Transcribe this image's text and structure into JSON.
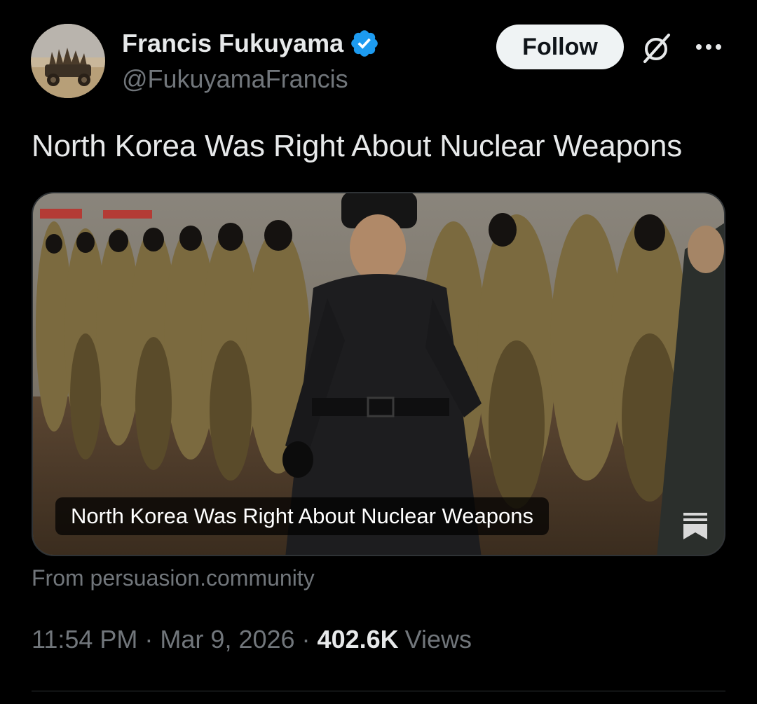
{
  "author": {
    "display_name": "Francis Fukuyama",
    "handle": "@FukuyamaFrancis",
    "verified": true,
    "verified_color": "#1d9bf0"
  },
  "actions": {
    "follow_label": "Follow",
    "grok_icon": "grok-icon",
    "more_icon": "more-horizontal-icon"
  },
  "tweet": {
    "text": "North Korea Was Right About Nuclear Weapons"
  },
  "card": {
    "title": "North Korea Was Right About Nuclear Weapons",
    "source": "From persuasion.community",
    "publisher_icon": "substack-icon"
  },
  "meta": {
    "time": "11:54 PM",
    "date": "Mar 9, 2026",
    "views_count": "402.6K",
    "views_label": "Views",
    "separator": "·"
  },
  "colors": {
    "background": "#000000",
    "text_primary": "#e7e9ea",
    "text_secondary": "#71767b",
    "follow_bg": "#eff3f4",
    "border": "#2f3336"
  }
}
